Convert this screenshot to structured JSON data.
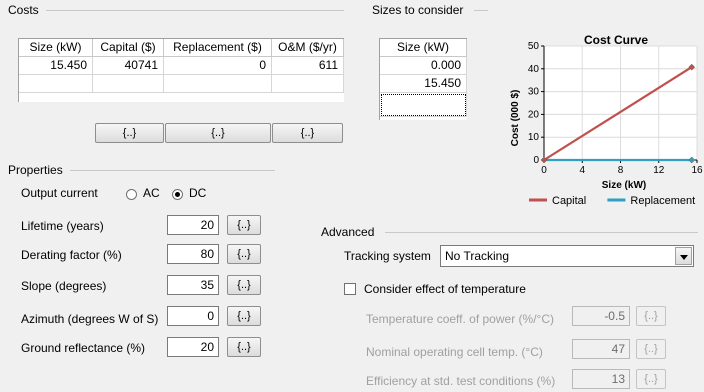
{
  "costs": {
    "group_label": "Costs",
    "columns": [
      "Size (kW)",
      "Capital ($)",
      "Replacement ($)",
      "O&M ($/yr)"
    ],
    "rows": [
      [
        "15.450",
        "40741",
        "0",
        "611"
      ]
    ],
    "buttons": [
      "{..}",
      "{..}",
      "{..}"
    ]
  },
  "sizes": {
    "group_label": "Sizes to consider",
    "column": "Size (kW)",
    "values": [
      "0.000",
      "15.450",
      ""
    ]
  },
  "chart_data": {
    "type": "line",
    "title": "Cost Curve",
    "xlabel": "Size (kW)",
    "ylabel": "Cost (000 $)",
    "xlim": [
      0,
      16
    ],
    "ylim": [
      0,
      50
    ],
    "x_ticks": [
      "0",
      "4",
      "8",
      "12",
      "16"
    ],
    "y_ticks": [
      "0",
      "10",
      "20",
      "30",
      "40",
      "50"
    ],
    "legend_position": "bottom",
    "series": [
      {
        "name": "Capital",
        "color": "#c0504d",
        "x": [
          0,
          15.45
        ],
        "y": [
          0,
          40.741
        ]
      },
      {
        "name": "Replacement",
        "color": "#31a0c0",
        "x": [
          0,
          15.45
        ],
        "y": [
          0,
          0
        ]
      }
    ]
  },
  "properties": {
    "group_label": "Properties",
    "output_current_label": "Output current",
    "ac_label": "AC",
    "dc_label": "DC",
    "selected": "DC",
    "button_label": "{..}",
    "fields": [
      {
        "label": "Lifetime (years)",
        "value": "20"
      },
      {
        "label": "Derating factor (%)",
        "value": "80"
      },
      {
        "label": "Slope (degrees)",
        "value": "35"
      },
      {
        "label": "Azimuth (degrees W of S)",
        "value": "0"
      },
      {
        "label": "Ground reflectance (%)",
        "value": "20"
      }
    ]
  },
  "advanced": {
    "group_label": "Advanced",
    "tracking_label": "Tracking system",
    "tracking_value": "No Tracking",
    "temperature_checkbox_label": "Consider effect of temperature",
    "temperature_checked": false,
    "button_label": "{..}",
    "fields": [
      {
        "label": "Temperature coeff. of power (%/°C)",
        "value": "-0.5"
      },
      {
        "label": "Nominal operating cell temp. (°C)",
        "value": "47"
      },
      {
        "label": "Efficiency at std. test conditions (%)",
        "value": "13"
      }
    ]
  }
}
